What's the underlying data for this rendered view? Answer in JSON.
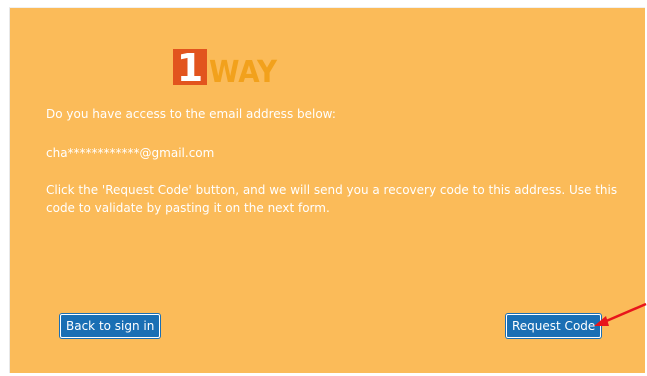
{
  "logo": {
    "digit": "1",
    "word": "WAY",
    "colors": {
      "digit_bg": "#e2541e",
      "digit_fg": "#ffffff",
      "word": "#f2a11c"
    }
  },
  "content": {
    "prompt": "Do you have access to the email address below:",
    "email": "cha************@gmail.com",
    "instructions": "Click the 'Request Code' button, and we will send you a recovery code to this address. Use this code to validate by pasting it on the next form."
  },
  "buttons": {
    "back_label": "Back to sign in",
    "request_label": "Request Code"
  },
  "colors": {
    "panel_bg": "#fbbb59",
    "button_bg": "#1a6fb4",
    "annotation_arrow": "#e8151b"
  }
}
